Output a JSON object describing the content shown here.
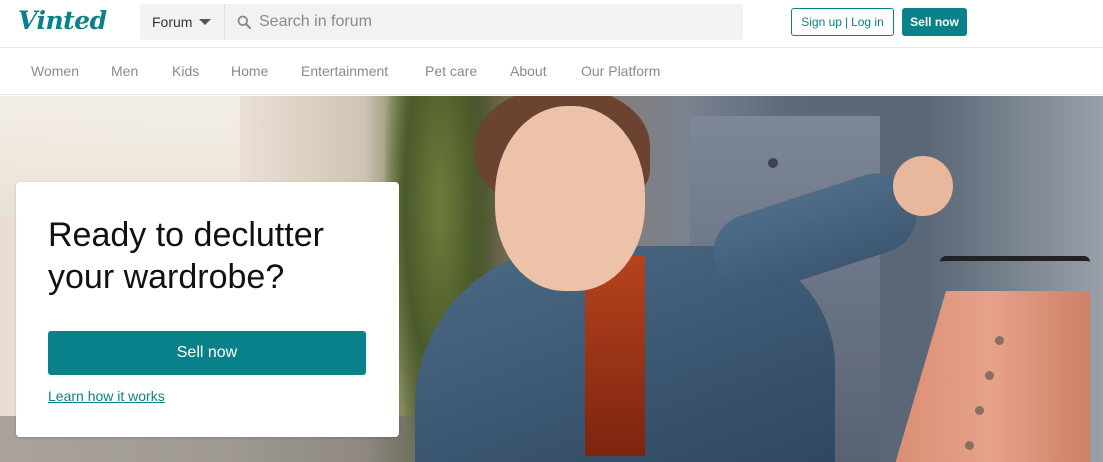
{
  "header": {
    "logo": "Vinted",
    "forum_select": "Forum",
    "search_placeholder": "Search in forum",
    "auth_signup": "Sign up",
    "auth_separator": "|",
    "auth_login": "Log in",
    "sell_now": "Sell now"
  },
  "nav": {
    "items": [
      "Women",
      "Men",
      "Kids",
      "Home",
      "Entertainment",
      "Pet care",
      "About",
      "Our Platform"
    ]
  },
  "hero": {
    "title": "Ready to declutter your wardrobe?",
    "cta": "Sell now",
    "link": "Learn how it works"
  },
  "colors": {
    "brand": "#09818a"
  }
}
